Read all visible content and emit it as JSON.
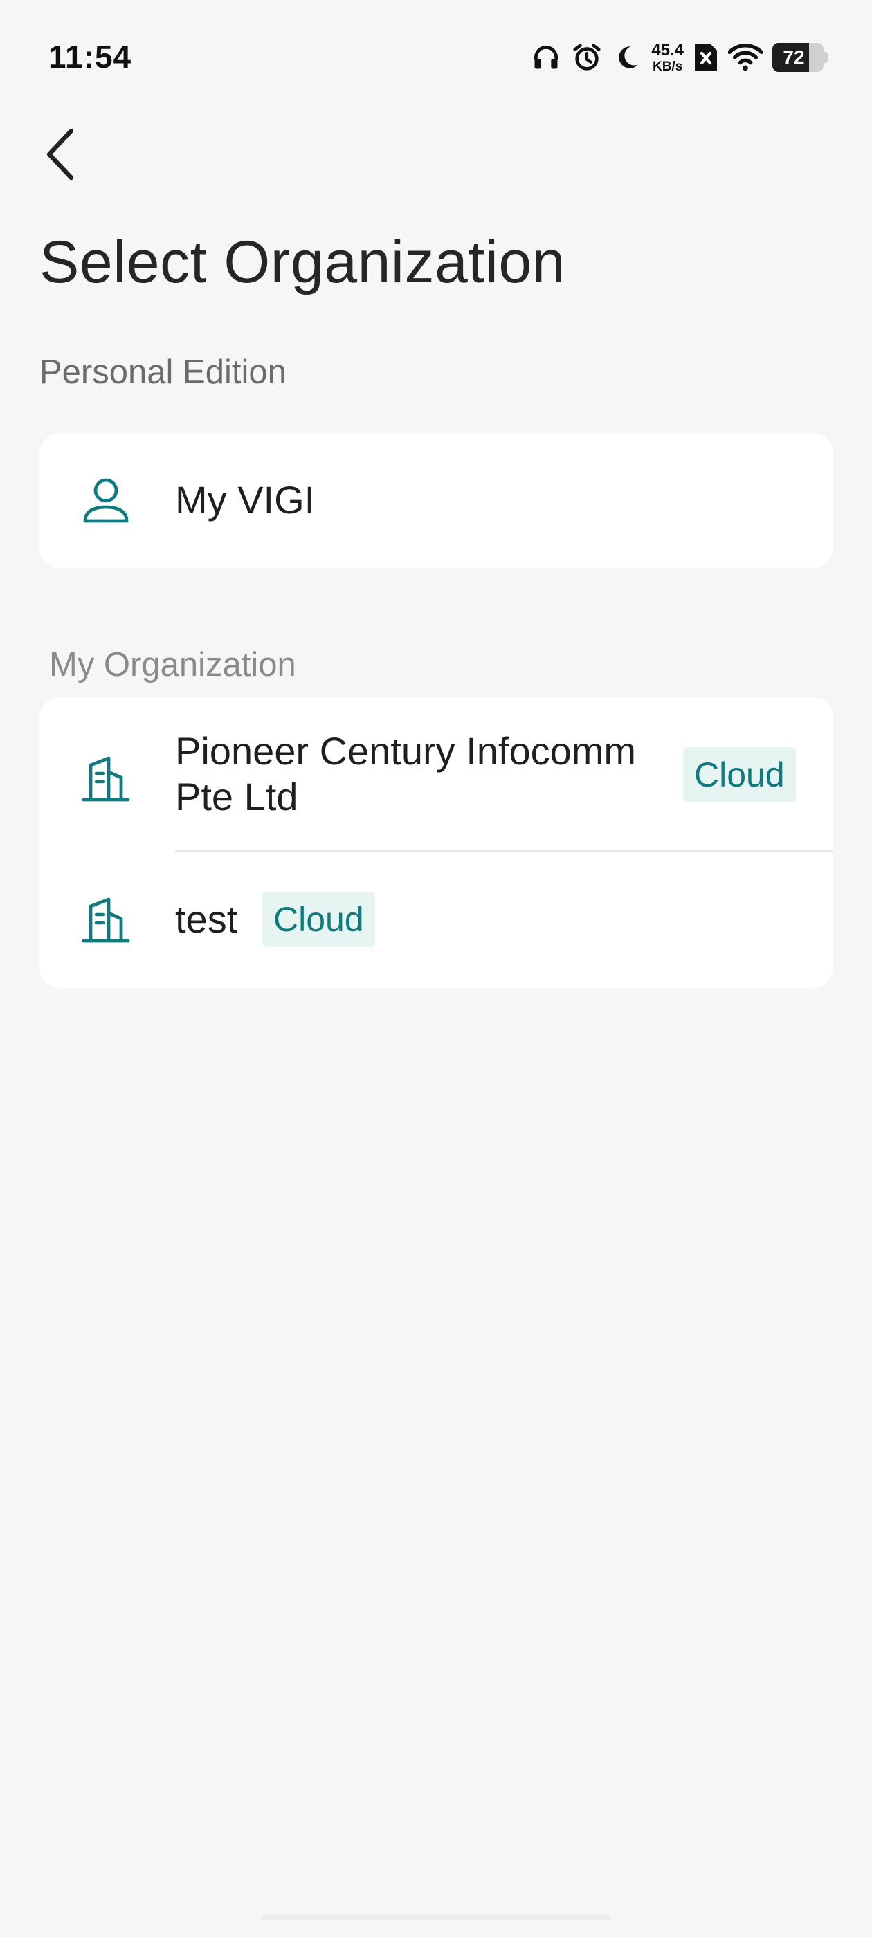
{
  "status_bar": {
    "time": "11:54",
    "net_speed_value": "45.4",
    "net_speed_unit": "KB/s",
    "battery_level": "72",
    "icons": [
      "headphones-icon",
      "alarm-icon",
      "moon-icon",
      "sim-none-icon",
      "wifi-icon",
      "battery-icon"
    ]
  },
  "header": {
    "back_icon": "chevron-left-icon",
    "title": "Select Organization"
  },
  "personal": {
    "section_label": "Personal Edition",
    "item": {
      "icon": "user-icon",
      "label": "My VIGI"
    }
  },
  "organizations": {
    "section_label": "My Organization",
    "items": [
      {
        "icon": "building-icon",
        "label_line1": "Pioneer Century Infocomm",
        "label_line2": "Pte Ltd",
        "badge": "Cloud"
      },
      {
        "icon": "building-icon",
        "label": "test",
        "badge": "Cloud"
      }
    ]
  },
  "colors": {
    "accent": "#0f7b80",
    "badge_bg": "#e6f4f2",
    "background": "#f6f6f6",
    "card": "#ffffff"
  }
}
